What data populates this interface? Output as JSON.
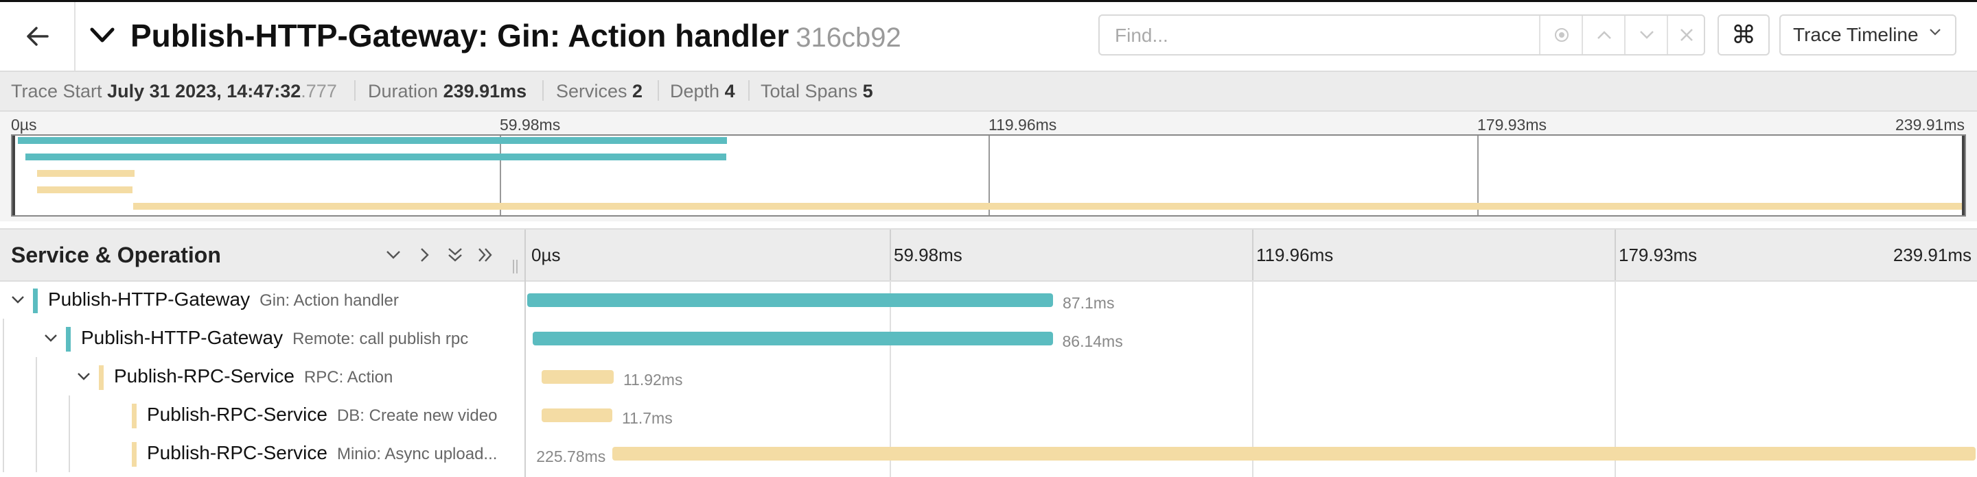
{
  "header": {
    "title": "Publish-HTTP-Gateway: Gin: Action handler",
    "trace_id": "316cb92",
    "find_placeholder": "Find...",
    "view_select": "Trace Timeline"
  },
  "summary": {
    "trace_start_label": "Trace Start",
    "trace_start_value": "July 31 2023, 14:47:32",
    "trace_start_ms": ".777",
    "duration_label": "Duration",
    "duration_value": "239.91ms",
    "services_label": "Services",
    "services_value": "2",
    "depth_label": "Depth",
    "depth_value": "4",
    "total_spans_label": "Total Spans",
    "total_spans_value": "5"
  },
  "timeline": {
    "total_ms": 239.91,
    "ticks": [
      "0µs",
      "59.98ms",
      "119.96ms",
      "179.93ms",
      "239.91ms"
    ]
  },
  "table": {
    "title": "Service & Operation"
  },
  "colors": {
    "gateway": "#5bbcc0",
    "rpc": "#f4dca4"
  },
  "spans": [
    {
      "service": "Publish-HTTP-Gateway",
      "operation": "Gin: Action handler",
      "depth": 0,
      "expanded": true,
      "start_ms": 0,
      "duration_ms": 87.1,
      "duration_label": "87.1ms",
      "color": "#5bbcc0"
    },
    {
      "service": "Publish-HTTP-Gateway",
      "operation": "Remote: call publish rpc",
      "depth": 1,
      "expanded": true,
      "start_ms": 0.9,
      "duration_ms": 86.14,
      "duration_label": "86.14ms",
      "color": "#5bbcc0"
    },
    {
      "service": "Publish-RPC-Service",
      "operation": "RPC: Action",
      "depth": 2,
      "expanded": true,
      "start_ms": 2.4,
      "duration_ms": 11.92,
      "duration_label": "11.92ms",
      "color": "#f4dca4"
    },
    {
      "service": "Publish-RPC-Service",
      "operation": "DB: Create new video",
      "depth": 3,
      "expanded": false,
      "start_ms": 2.4,
      "duration_ms": 11.7,
      "duration_label": "11.7ms",
      "color": "#f4dca4"
    },
    {
      "service": "Publish-RPC-Service",
      "operation": "Minio: Async upload...",
      "depth": 3,
      "expanded": false,
      "start_ms": 14.13,
      "duration_ms": 225.78,
      "duration_label": "225.78ms",
      "color": "#f4dca4"
    }
  ]
}
